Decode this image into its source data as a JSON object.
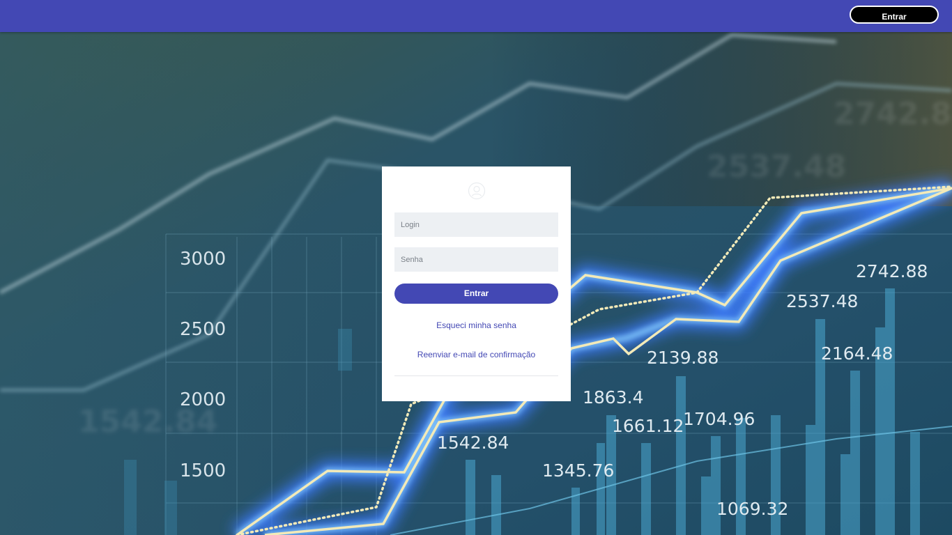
{
  "header": {
    "login_button_label": "Entrar",
    "bar_color": "#4348b4"
  },
  "login_card": {
    "logo_icon": "user-circle-icon",
    "login_placeholder": "Login",
    "password_placeholder": "Senha",
    "submit_label": "Entrar",
    "forgot_password_link": "Esqueci minha senha",
    "resend_email_link": "Reenviar e-mail de confirmação"
  },
  "background": {
    "description_icon": "stock-chart-background",
    "y_axis_labels": [
      "3000",
      "2500",
      "2000",
      "1500"
    ],
    "value_labels": [
      "2742.88",
      "2537.48",
      "2139.88",
      "2164.48",
      "1863.4",
      "1661.12",
      "1704.96",
      "1542.84",
      "1345.76",
      "1069.32"
    ],
    "ghost_labels": [
      "2742.88",
      "2537.48",
      "1542.84"
    ]
  }
}
